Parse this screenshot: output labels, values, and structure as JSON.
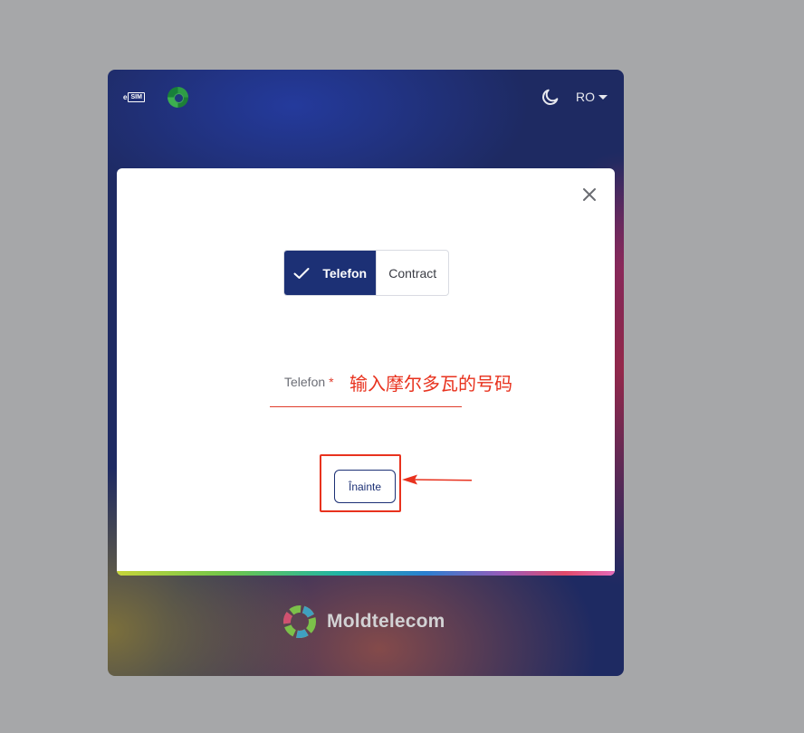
{
  "header": {
    "esim_logo_e": "e",
    "esim_logo_sim": "SIM",
    "language": "RO",
    "icons": {
      "theme": "moon-icon",
      "flag": "moldova-flag-icon",
      "lang_caret": "caret-down-icon"
    }
  },
  "modal": {
    "close_icon": "close-icon",
    "toggle": {
      "active_label": "Telefon",
      "active_icon": "check-icon",
      "inactive_label": "Contract"
    },
    "phone_field": {
      "label": "Telefon",
      "required_mark": "*",
      "value": "",
      "placeholder": ""
    },
    "annotation": "输入摩尔多瓦的号码",
    "next_button": "Înainte"
  },
  "footer": {
    "brand": "Moldtelecom"
  },
  "colors": {
    "primary": "#1c3075",
    "annotation_red": "#e8321e",
    "page_background": "#a6a7a9",
    "app_background": "#1e2a62"
  }
}
